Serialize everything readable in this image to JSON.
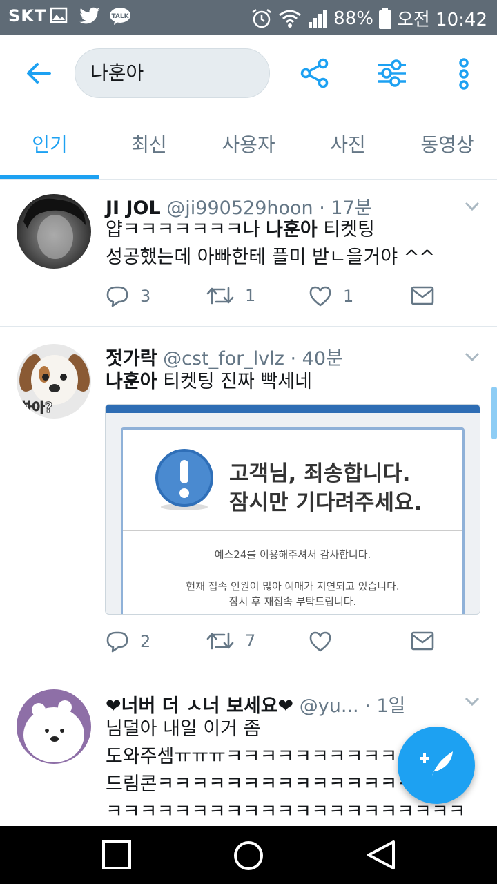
{
  "status": {
    "carrier": "SKT",
    "battery": "88%",
    "time": "오전 10:42"
  },
  "header": {
    "search_value": "나훈아"
  },
  "tabs": [
    {
      "label": "인기",
      "active": true
    },
    {
      "label": "최신"
    },
    {
      "label": "사용자"
    },
    {
      "label": "사진"
    },
    {
      "label": "동영상"
    }
  ],
  "tweets": [
    {
      "name": "JI JOL",
      "handle": "@ji990529hoon",
      "time": "· 17분",
      "lines": [
        {
          "pre": "얍ㅋㅋㅋㅋㅋㅋㅋ나 ",
          "bold": "나훈아",
          "post": " 티켓팅"
        },
        {
          "pre": "성공했는데 아빠한테 플미 받ㄴ을거야 ^^",
          "bold": "",
          "post": ""
        }
      ],
      "replies": "3",
      "retweets": "1",
      "likes": "1"
    },
    {
      "name": "젓가락",
      "handle": "@cst_for_lvlz",
      "time": "· 40분",
      "lines": [
        {
          "pre": "",
          "bold": "나훈아",
          "post": " 티켓팅 진짜 빡세네"
        }
      ],
      "avatar_caption": "하아?",
      "media": {
        "heading1": "고객님, 죄송합니다.",
        "heading2": "잠시만 기다려주세요.",
        "line1": "예스24를 이용해주셔서 감사합니다.",
        "line2": "현재 접속 인원이 많아 예매가 지연되고 있습니다.",
        "line3": "잠시 후 재접속 부탁드립니다."
      },
      "replies": "2",
      "retweets": "7",
      "likes": ""
    },
    {
      "name": "❤너버 더 ㅅ너 보세요❤",
      "handle": "@yu...",
      "time": "· 1일",
      "lines": [
        {
          "pre": "님덜아 내일 이거 좀",
          "bold": "",
          "post": ""
        },
        {
          "pre": "도와주셈ㅠㅠㅠㅋㅋㅋㅋㅋㅋㅋㅋㅋㅋ",
          "bold": "",
          "post": ""
        },
        {
          "pre": "드림콘ㅋㅋㅋㅋㅋㅋㅋㅋㅋㅋㅋㅋㅋㅋㅋㅋ",
          "bold": "",
          "post": ""
        },
        {
          "pre": "ㅋㅋㅋㅋㅋㅋㅋㅋㅋㅋㅋㅋㅋㅋㅋㅋㅋㅋㅋㅋㅋ",
          "bold": "",
          "post": ""
        }
      ]
    }
  ],
  "colors": {
    "accent": "#1da1f2",
    "status_bar": "#5f6b76",
    "secondary_text": "#657786"
  }
}
